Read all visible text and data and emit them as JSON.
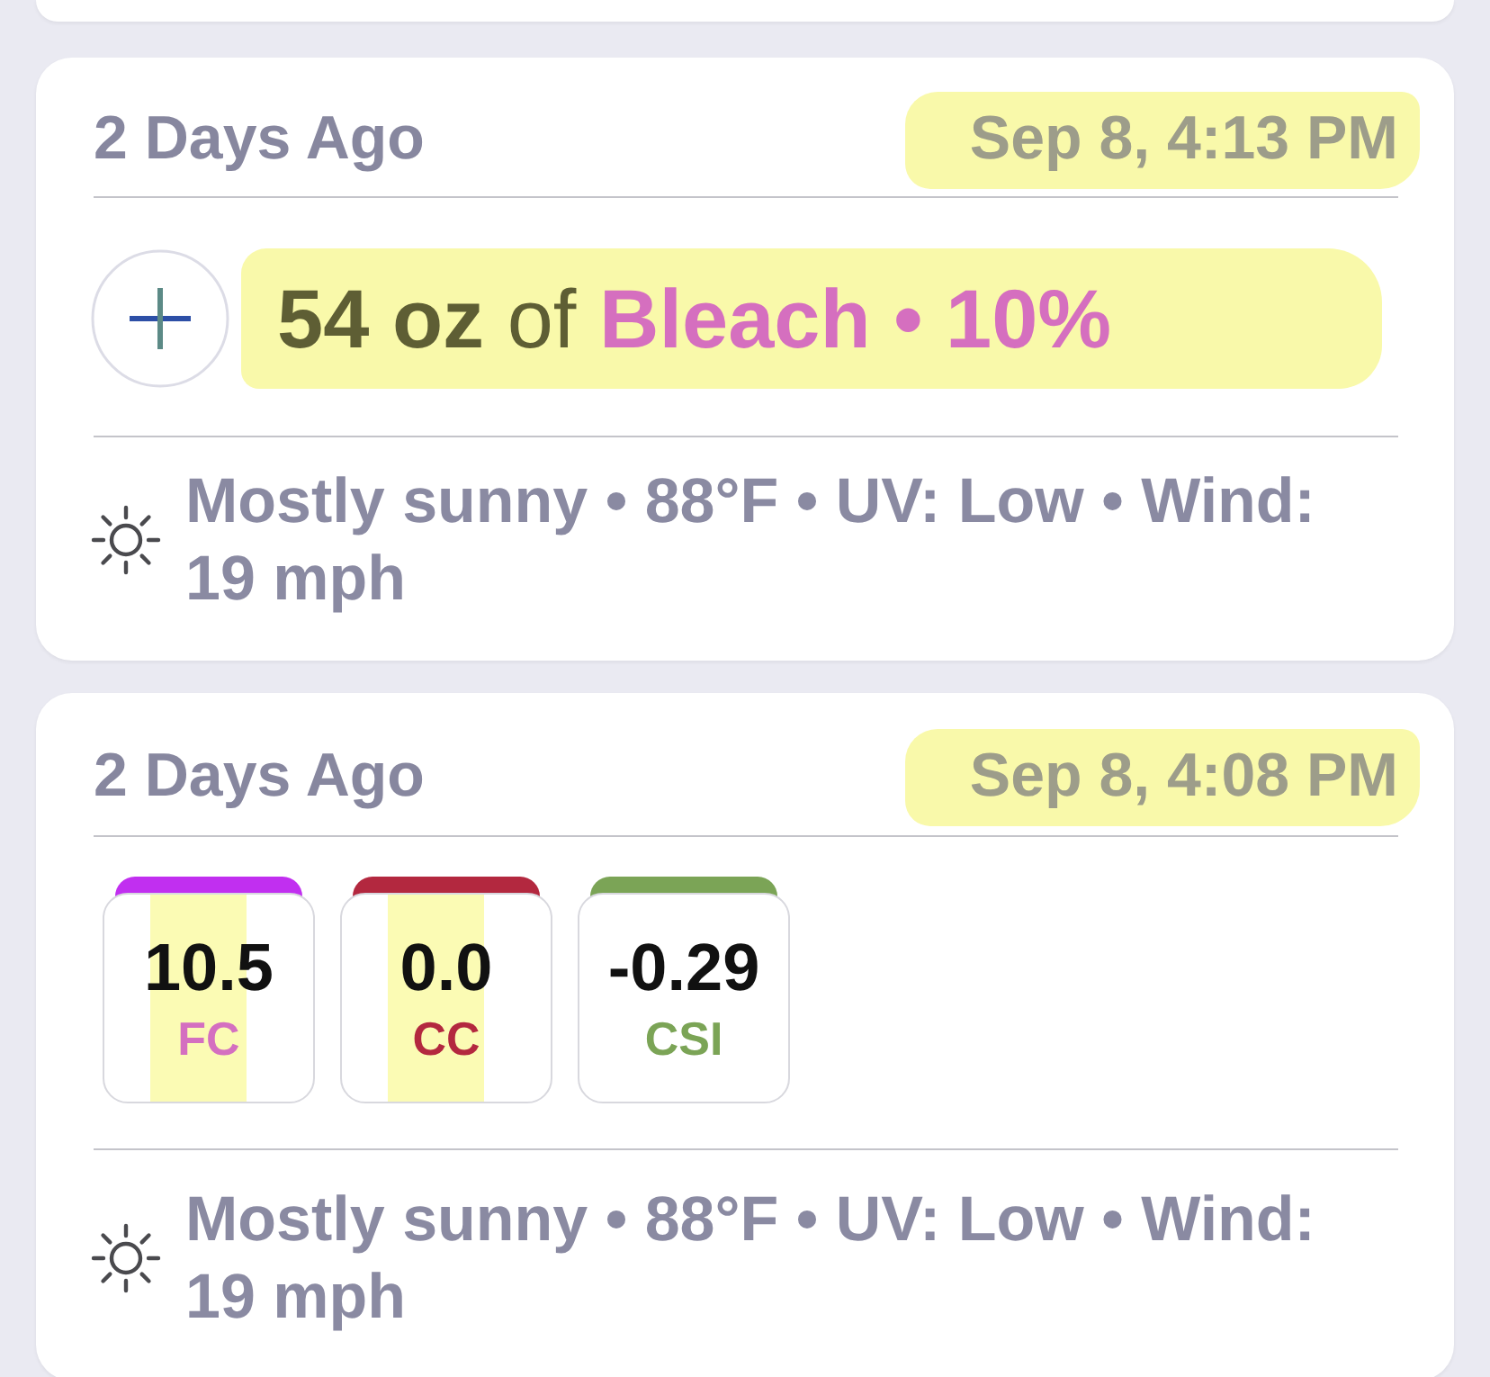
{
  "entries": [
    {
      "kind": "dose",
      "relative_time": "2 Days Ago",
      "timestamp": "Sep 8, 4:13 PM",
      "timestamp_highlighted": true,
      "amount": "54 oz",
      "connector": "of",
      "chemical": "Bleach • 10%",
      "dose_highlighted": true,
      "weather": "Mostly sunny • 88°F • UV: Low • Wind: 19 mph"
    },
    {
      "kind": "readings",
      "relative_time": "2 Days Ago",
      "timestamp": "Sep 8, 4:08 PM",
      "timestamp_highlighted": true,
      "readings": [
        {
          "value": "10.5",
          "label": {
            "text": "FC",
            "color": "#d46fc0"
          },
          "tab": {
            "color": "#c12ff0"
          },
          "highlighted": true
        },
        {
          "value": "0.0",
          "label": {
            "text": "CC",
            "color": "#b3283f"
          },
          "tab": {
            "color": "#b3283f"
          },
          "highlighted": true
        },
        {
          "value": "-0.29",
          "label": {
            "text": "CSI",
            "color": "#7ba456"
          },
          "tab": {
            "color": "#7ba456"
          },
          "highlighted": false
        }
      ],
      "weather": "Mostly sunny • 88°F • UV: Low • Wind: 19 mph"
    }
  ]
}
